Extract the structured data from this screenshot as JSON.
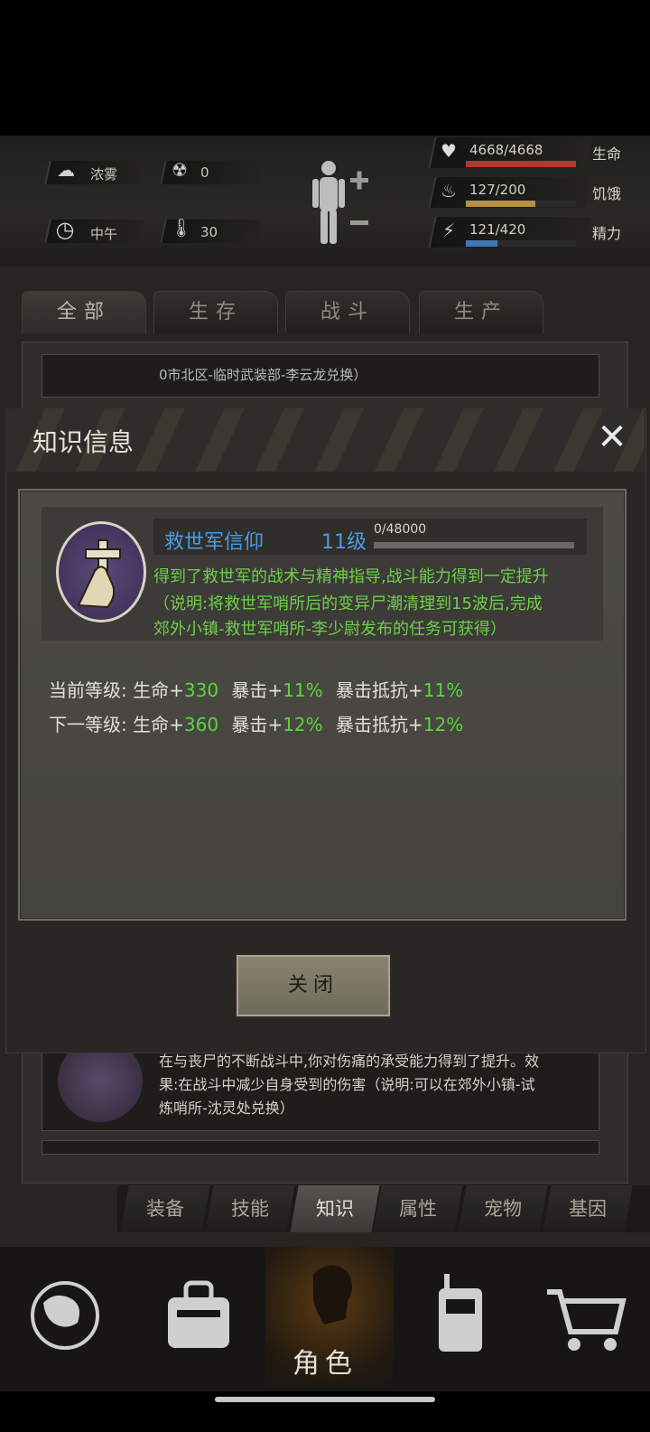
{
  "status": {
    "weather": "浓雾",
    "radiation": "0",
    "time": "中午",
    "temperature": "30",
    "health": {
      "value": "4668/4668",
      "label": "生命",
      "fraction": 1.0,
      "color": "#b13a30"
    },
    "hunger": {
      "value": "127/200",
      "label": "饥饿",
      "fraction": 0.635,
      "color": "#b79244"
    },
    "energy": {
      "value": "121/420",
      "label": "精力",
      "fraction": 0.288,
      "color": "#4178b8"
    }
  },
  "tabs": [
    "全部",
    "生存",
    "战斗",
    "生产"
  ],
  "modal": {
    "title": "知识信息",
    "knowledge": {
      "name": "救世军信仰",
      "level": "11级",
      "progress_text": "0/48000",
      "progress": 0,
      "description": "得到了救世军的战术与精神指导,战斗能力得到一定提升",
      "note_line1": "（说明:将救世军哨所后的变异尸潮清理到15波后,完成",
      "note_line2": "郊外小镇-救世军哨所-李少尉发布的任务可获得）"
    },
    "current": {
      "label": "当前等级:",
      "hp_label": "生命+",
      "hp": "330",
      "crit_label": "暴击+",
      "crit": "11%",
      "res_label": "暴击抵抗+",
      "res": "11%"
    },
    "next": {
      "label": "下一等级:",
      "hp_label": "生命+",
      "hp": "360",
      "crit_label": "暴击+",
      "crit": "12%",
      "res_label": "暴击抵抗+",
      "res": "12%"
    },
    "close_button": "关闭"
  },
  "background_list": {
    "top_text": "0市北区-临时武装部-李云龙兑换）",
    "bottom_text1": "在与丧尸的不断战斗中,你对伤痛的承受能力得到了提升。效",
    "bottom_text2": "果:在战斗中减少自身受到的伤害（说明:可以在郊外小镇-试",
    "bottom_text3": "炼哨所-沈灵处兑换）"
  },
  "subtabs": [
    "装备",
    "技能",
    "知识",
    "属性",
    "宠物",
    "基因"
  ],
  "active_subtab": "知识",
  "nav": {
    "active_label": "角色"
  }
}
